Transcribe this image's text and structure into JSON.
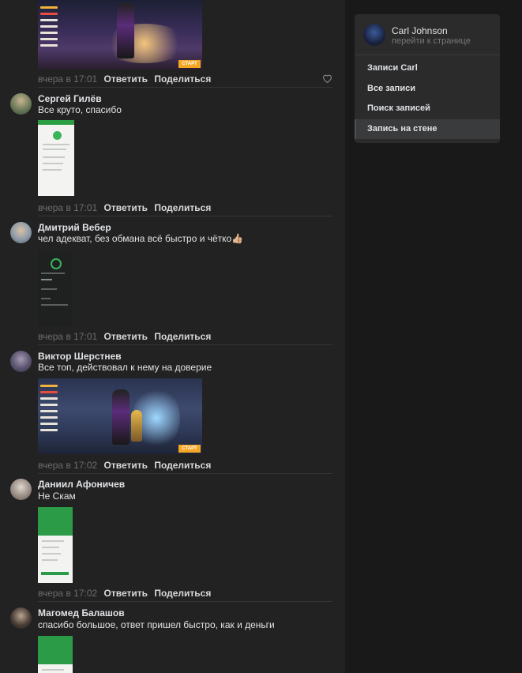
{
  "comments": [
    {
      "author": "",
      "text": "",
      "date": "вчера в 17:01",
      "reply": "Ответить",
      "share": "Поделиться"
    },
    {
      "author": "Сергей Гилёв",
      "text": "Все круто, спасибо",
      "date": "вчера в 17:01",
      "reply": "Ответить",
      "share": "Поделиться"
    },
    {
      "author": "Дмитрий Вебер",
      "text": "чел адекват, без обмана всё быстро и чётко👍🏼",
      "date": "вчера в 17:01",
      "reply": "Ответить",
      "share": "Поделиться"
    },
    {
      "author": "Виктор Шерстнев",
      "text": "Все топ, действовал к нему на доверие",
      "date": "вчера в 17:02",
      "reply": "Ответить",
      "share": "Поделиться"
    },
    {
      "author": "Даниил Афоничев",
      "text": "Не Скам",
      "date": "вчера в 17:02",
      "reply": "Ответить",
      "share": "Поделиться"
    },
    {
      "author": "Магомед Балашов",
      "text": "спасибо большое, ответ пришел быстро, как и деньги"
    }
  ],
  "game_button": "СТАРТ",
  "menu": {
    "profile_name": "Carl Johnson",
    "profile_link": "перейти к странице",
    "items": [
      {
        "label": "Записи Carl"
      },
      {
        "label": "Все записи"
      },
      {
        "label": "Поиск записей"
      },
      {
        "label": "Запись на стене"
      }
    ]
  },
  "colors": {
    "page_bg": "#19191a",
    "feed_bg": "#222222",
    "menu_bg": "#2b2b2c",
    "accent_green": "#2c9b48",
    "game_start": "#f5a623"
  },
  "icons": {
    "like": "heart-icon"
  }
}
